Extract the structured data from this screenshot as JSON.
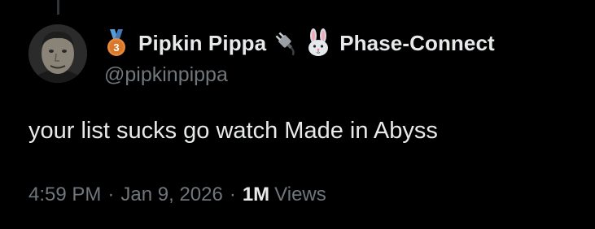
{
  "author": {
    "display_name": "Pipkin Pippa",
    "affiliation": "Phase-Connect",
    "handle": "@pipkinpippa",
    "badge_icons": [
      "bronze-medal-icon",
      "plug-icon",
      "rabbit-icon"
    ],
    "medal_number": "3"
  },
  "tweet": {
    "text": "your list sucks go watch Made in Abyss",
    "time": "4:59 PM",
    "separator": "·",
    "date": "Jan 9, 2026",
    "views_count": "1M",
    "views_label": "Views"
  },
  "colors": {
    "background": "#000000",
    "primary_text": "#e7e9ea",
    "secondary_text": "#71767b",
    "thread_line": "#333639",
    "medal_bronze": "#e8893a",
    "medal_ribbon": "#5b9bd5"
  }
}
